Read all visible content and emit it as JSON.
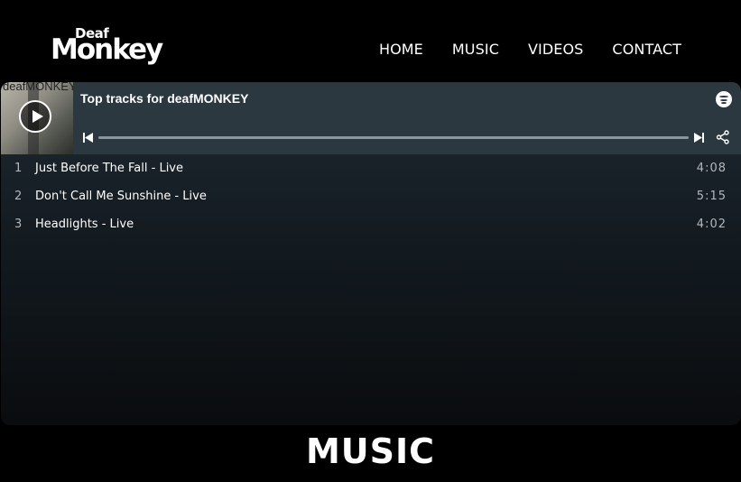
{
  "logo": {
    "top": "Deaf",
    "bottom": "Monkey"
  },
  "nav": {
    "items": [
      "HOME",
      "MUSIC",
      "VIDEOS",
      "CONTACT"
    ]
  },
  "player": {
    "cover_text": "deafMONKEY",
    "title": "Top tracks for deafMONKEY",
    "tracks": [
      {
        "num": "1",
        "name": "Just Before The Fall - Live",
        "duration": "4:08"
      },
      {
        "num": "2",
        "name": "Don't Call Me Sunshine - Live",
        "duration": "5:15"
      },
      {
        "num": "3",
        "name": "Headlights - Live",
        "duration": "4:02"
      }
    ],
    "icons": {
      "brand": "spotify-icon",
      "play": "play-icon",
      "prev": "skip-back-icon",
      "next": "skip-forward-icon",
      "share": "share-icon"
    }
  },
  "section": {
    "title": "MUSIC"
  },
  "colors": {
    "background": "#000000",
    "player_header": "#2b3840",
    "progress_track": "#8c959a"
  }
}
